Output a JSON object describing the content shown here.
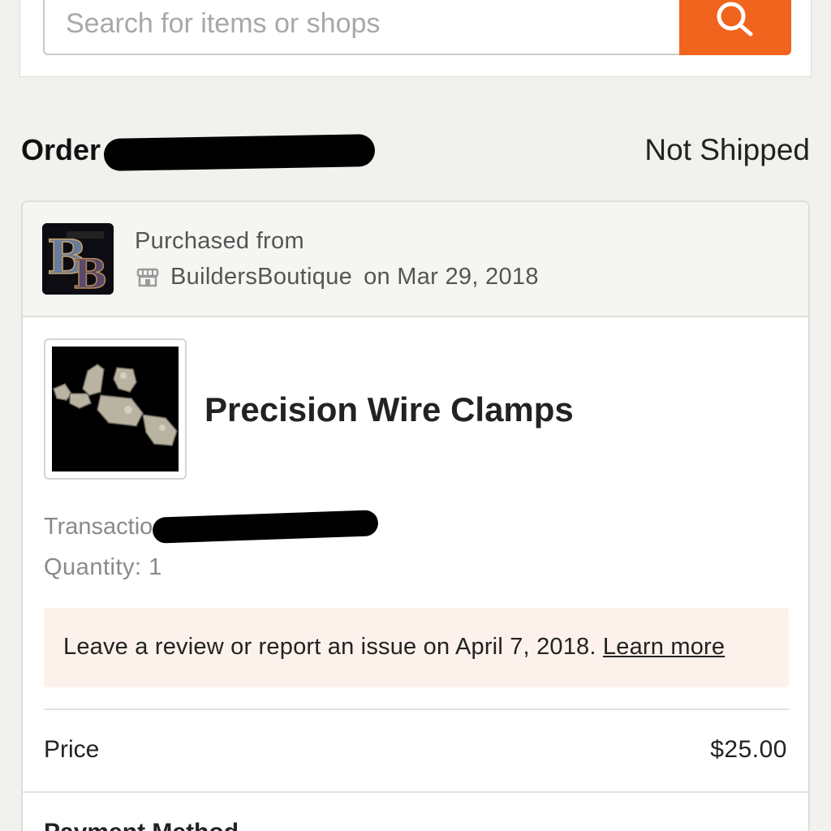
{
  "search": {
    "placeholder": "Search for items or shops"
  },
  "order": {
    "title": "Order",
    "status": "Not Shipped"
  },
  "shop": {
    "purchased_label": "Purchased from",
    "name": "BuildersBoutique",
    "date_text": "on Mar 29, 2018"
  },
  "item": {
    "title": "Precision Wire Clamps",
    "transaction_label": "Transactio",
    "quantity_text": "Quantity: 1"
  },
  "notice": {
    "text": "Leave a review or report an issue on April 7, 2018.",
    "link": "Learn more"
  },
  "summary": {
    "price_label": "Price",
    "price_value": "$25.00",
    "payment_label": "Payment Method"
  },
  "colors": {
    "accent": "#f1641e",
    "notice_bg": "#fdf1ec"
  }
}
